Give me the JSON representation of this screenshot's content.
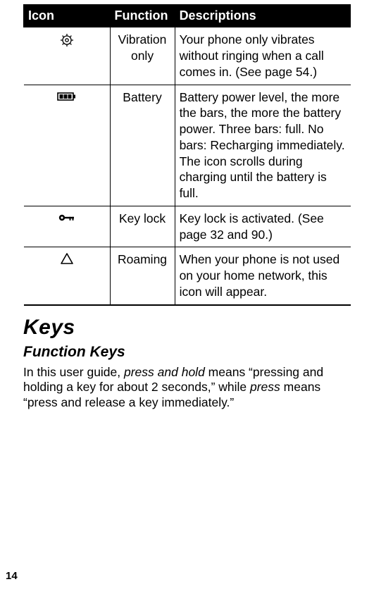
{
  "table": {
    "headers": {
      "icon": "Icon",
      "function": "Function",
      "descriptions": "Descriptions"
    },
    "rows": [
      {
        "icon_name": "vibration-only-icon",
        "function": "Vibration only",
        "description": "Your phone only vibrates without ringing when a call comes in. (See page 54.)"
      },
      {
        "icon_name": "battery-icon",
        "function": "Battery",
        "description": "Battery power level, the more the bars, the more the battery power. Three bars: full. No bars: Recharging immediately. The icon scrolls during charging until the battery is full."
      },
      {
        "icon_name": "key-lock-icon",
        "function": "Key lock",
        "description": "Key lock is activated. (See page 32 and 90.)"
      },
      {
        "icon_name": "roaming-icon",
        "function": "Roaming",
        "description": "When your phone is not used on your home network, this icon will appear."
      }
    ]
  },
  "sections": {
    "keys_title": "Keys",
    "function_keys_title": "Function Keys",
    "body": {
      "seg1": "In this user guide, ",
      "term1": "press and hold",
      "seg2": " means “pressing and holding a key for about 2 seconds,” while ",
      "term2": "press",
      "seg3": " means “press and release a key immediately.”"
    }
  },
  "page_number": "14"
}
